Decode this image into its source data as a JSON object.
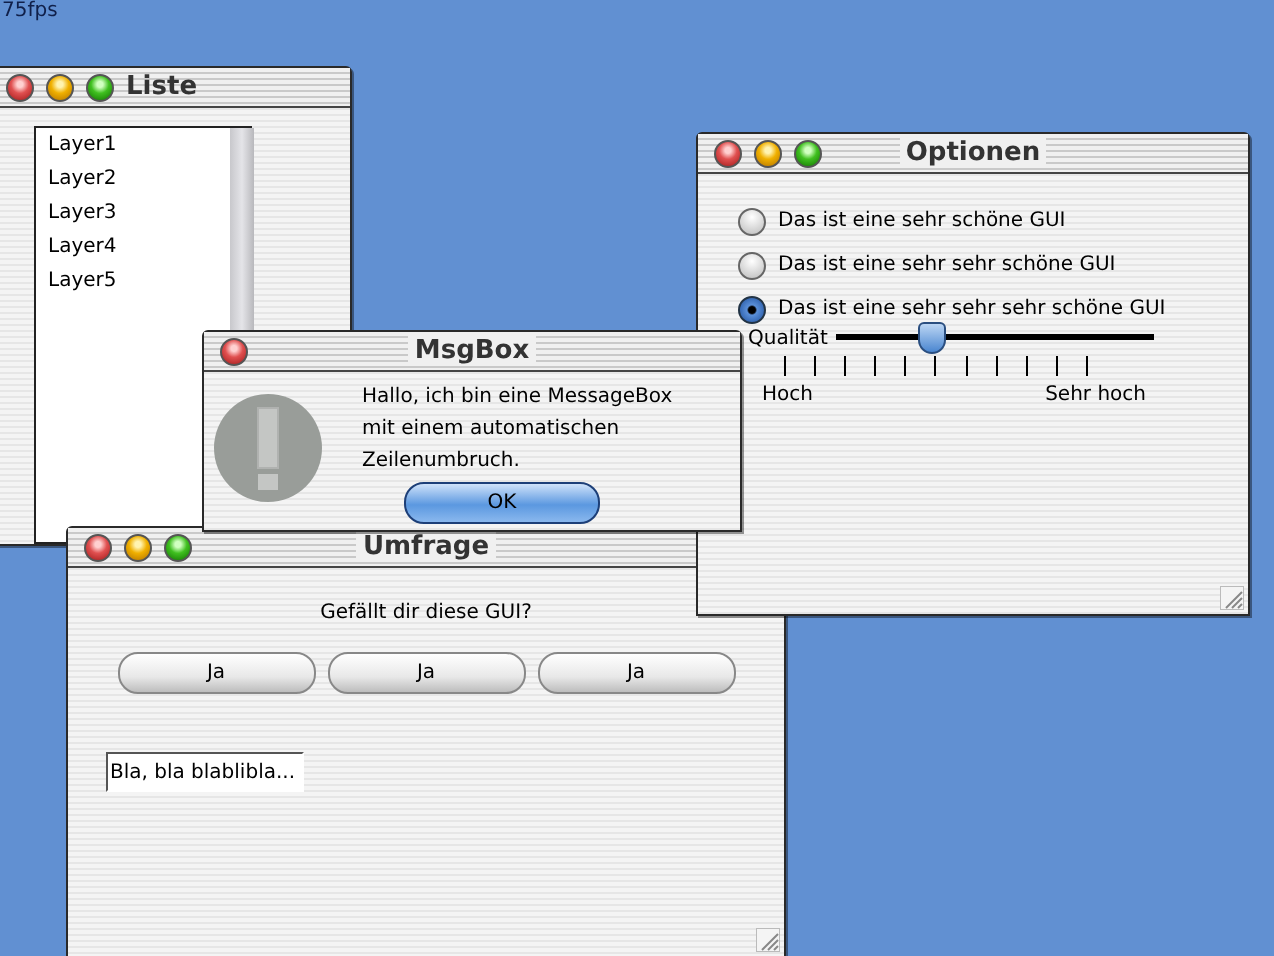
{
  "fps": "75fps",
  "windows": [
    {
      "kind": "list",
      "title": "Liste",
      "items": [
        "Layer1",
        "Layer2",
        "Layer3",
        "Layer4",
        "Layer5"
      ]
    },
    {
      "kind": "survey",
      "title": "Umfrage",
      "question": "Gefällt dir diese GUI?",
      "buttons": [
        "Ja",
        "Ja",
        "Ja"
      ],
      "field": {
        "value": "Bla, bla blablibla..."
      }
    },
    {
      "kind": "options",
      "title": "Optionen",
      "radios": [
        {
          "label": "Das ist eine sehr schöne GUI",
          "selected": false
        },
        {
          "label": "Das ist eine sehr sehr schöne GUI",
          "selected": false
        },
        {
          "label": "Das ist eine sehr sehr sehr schöne GUI",
          "selected": true
        }
      ],
      "slider": {
        "label": "Qualität",
        "level": 0.3,
        "min_label": "Hoch",
        "max_label": "Sehr hoch"
      }
    },
    {
      "kind": "message",
      "title": "MsgBox",
      "lines": [
        "Hallo, ich bin eine MessageBox",
        "mit einem automatischen",
        "Zeilenumbruch."
      ],
      "button": "OK"
    }
  ]
}
